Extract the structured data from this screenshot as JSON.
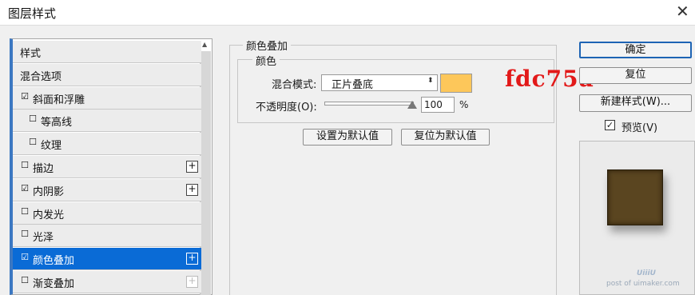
{
  "window": {
    "title": "图层样式",
    "close_glyph": "✕"
  },
  "style_list": {
    "items": [
      {
        "label": "样式",
        "checkbox": null,
        "plus": false,
        "selected": false,
        "indent": 0
      },
      {
        "label": "混合选项",
        "checkbox": null,
        "plus": false,
        "selected": false,
        "indent": 0
      },
      {
        "label": "斜面和浮雕",
        "checkbox": "☑",
        "plus": false,
        "selected": false,
        "indent": 0
      },
      {
        "label": "等高线",
        "checkbox": "☐",
        "plus": false,
        "selected": false,
        "indent": 1
      },
      {
        "label": "纹理",
        "checkbox": "☐",
        "plus": false,
        "selected": false,
        "indent": 1
      },
      {
        "label": "描边",
        "checkbox": "☐",
        "plus": true,
        "selected": false,
        "indent": 0
      },
      {
        "label": "内阴影",
        "checkbox": "☑",
        "plus": true,
        "selected": false,
        "indent": 0
      },
      {
        "label": "内发光",
        "checkbox": "☐",
        "plus": false,
        "selected": false,
        "indent": 0
      },
      {
        "label": "光泽",
        "checkbox": "☐",
        "plus": false,
        "selected": false,
        "indent": 0
      },
      {
        "label": "颜色叠加",
        "checkbox": "☑",
        "plus": true,
        "selected": true,
        "indent": 0
      },
      {
        "label": "渐变叠加",
        "checkbox": "☐",
        "plus": true,
        "plus_dim": true,
        "selected": false,
        "indent": 0
      }
    ],
    "plus_glyph": "+"
  },
  "color_overlay": {
    "group_label": "颜色叠加",
    "subgroup_label": "颜色",
    "blend_label": "混合模式:",
    "blend_value": "正片叠底",
    "blend_arrow": "⬍",
    "swatch_color": "#fdc75a",
    "opacity_label": "不透明度(O):",
    "opacity_value": "100",
    "opacity_unit": "%",
    "opacity_fraction": 1.0,
    "annotation_hex": "fdc75a",
    "make_default_label": "设置为默认值",
    "reset_default_label": "复位为默认值"
  },
  "actions": {
    "ok_label": "确定",
    "reset_label": "复位",
    "new_style_label": "新建样式(W)...",
    "preview_label": "预览(V)",
    "preview_checked": "✓",
    "preview_color": "#5a4520"
  },
  "watermark": {
    "logo": "UiiiU",
    "site": "post of uimaker.com"
  },
  "colors": {
    "selection": "#0a6bd6",
    "annotation": "#e21919",
    "list_accent": "#3c78c2"
  }
}
